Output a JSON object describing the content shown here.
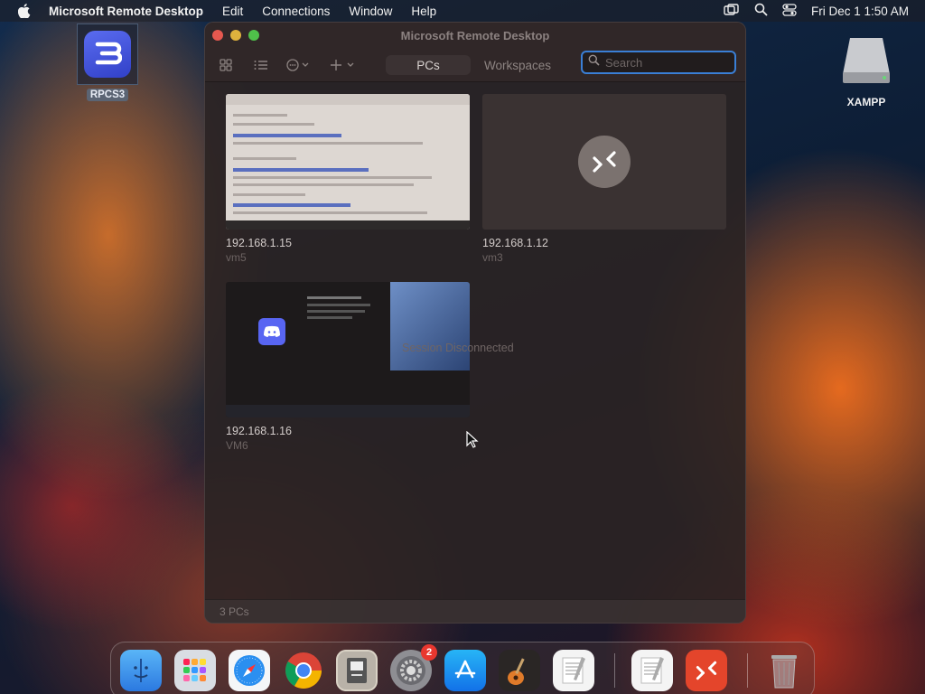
{
  "menubar": {
    "app_name": "Microsoft Remote Desktop",
    "items": [
      "Edit",
      "Connections",
      "Window",
      "Help"
    ],
    "clock": "Fri Dec 1  1:50 AM"
  },
  "desktop": {
    "rpcs3_label": "RPCS3",
    "xampp_label": "XAMPP"
  },
  "window": {
    "title": "Microsoft Remote Desktop",
    "tabs": [
      "PCs",
      "Workspaces"
    ],
    "active_tab": "PCs",
    "search": {
      "value": "",
      "placeholder": "Search"
    },
    "pcs": [
      {
        "name": "192.168.1.15",
        "sub": "vm5"
      },
      {
        "name": "192.168.1.12",
        "sub": "vm3"
      },
      {
        "name": "192.168.1.16",
        "sub": "VM6"
      }
    ],
    "session_text": "Session Disconnected",
    "status": "3 PCs"
  },
  "dock": {
    "items": [
      "Finder",
      "Launchpad",
      "Safari",
      "Google Chrome",
      "Preview",
      "System Settings",
      "App Store",
      "GarageBand",
      "TextEdit",
      "TextEdit",
      "Microsoft Remote Desktop",
      "Trash"
    ],
    "settings_badge": "2"
  },
  "colors": {
    "accent": "#3a7fd6",
    "window_bg": "#2b2424"
  }
}
